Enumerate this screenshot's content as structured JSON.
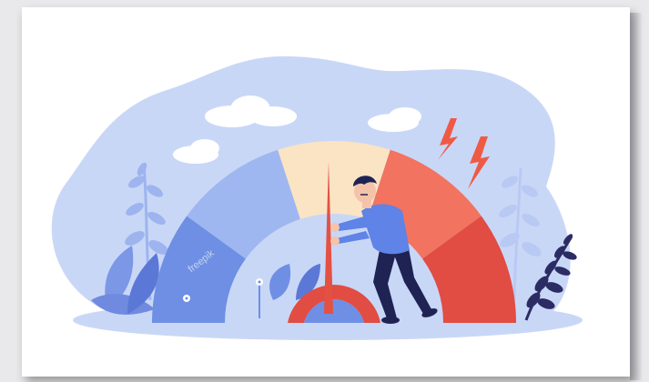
{
  "illustration": {
    "watermark": "freepik",
    "gauge": {
      "segments": [
        {
          "name": "low",
          "color": "#6e8fe3"
        },
        {
          "name": "medium-low",
          "color": "#9fb7f0"
        },
        {
          "name": "medium",
          "color": "#fae4c4"
        },
        {
          "name": "medium-high",
          "color": "#f2735f"
        },
        {
          "name": "high",
          "color": "#e14c43"
        }
      ],
      "needle_color": "#e45143",
      "level": 0.5
    },
    "colors": {
      "background_blob": "#c9d7f7",
      "cloud": "#ffffff",
      "lightning": "#ef5a45",
      "leaf_light": "#9db4ef",
      "leaf_dark": "#2c2c64",
      "shirt": "#5f83e6",
      "pants": "#1e2354"
    }
  }
}
